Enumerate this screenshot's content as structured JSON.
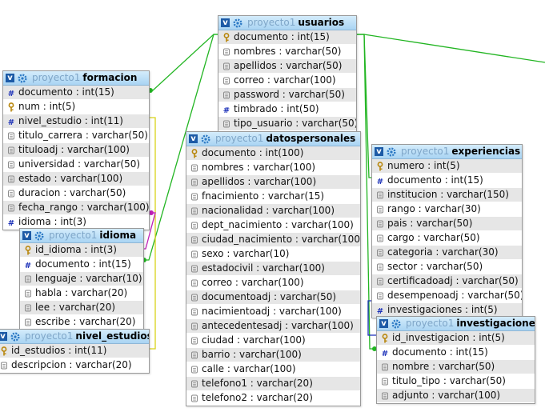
{
  "tables": {
    "usuarios": {
      "db": "proyecto1",
      "name": "usuarios",
      "columns": [
        {
          "icon": "key",
          "text": "documento : int(15)"
        },
        {
          "icon": "varchar",
          "text": "nombres : varchar(50)"
        },
        {
          "icon": "varchar",
          "text": "apellidos : varchar(50)"
        },
        {
          "icon": "varchar",
          "text": "correo : varchar(100)"
        },
        {
          "icon": "varchar",
          "text": "password : varchar(50)"
        },
        {
          "icon": "int",
          "text": "timbrado : int(50)"
        },
        {
          "icon": "varchar",
          "text": "tipo_usuario : varchar(50)"
        }
      ]
    },
    "formacion": {
      "db": "proyecto1",
      "name": "formacion",
      "columns": [
        {
          "icon": "int",
          "text": "documento : int(15)"
        },
        {
          "icon": "key",
          "text": "num : int(5)"
        },
        {
          "icon": "int",
          "text": "nivel_estudio : int(11)"
        },
        {
          "icon": "varchar",
          "text": "titulo_carrera : varchar(50)"
        },
        {
          "icon": "varchar",
          "text": "tituloadj : varchar(100)"
        },
        {
          "icon": "varchar",
          "text": "universidad : varchar(50)"
        },
        {
          "icon": "varchar",
          "text": "estado : varchar(100)"
        },
        {
          "icon": "varchar",
          "text": "duracion : varchar(50)"
        },
        {
          "icon": "varchar",
          "text": "fecha_rango : varchar(100)"
        },
        {
          "icon": "int",
          "text": "idioma : int(3)"
        }
      ]
    },
    "idioma": {
      "db": "proyecto1",
      "name": "idioma",
      "columns": [
        {
          "icon": "key",
          "text": "id_idioma : int(3)"
        },
        {
          "icon": "int",
          "text": "documento : int(15)"
        },
        {
          "icon": "varchar",
          "text": "lenguaje : varchar(10)"
        },
        {
          "icon": "varchar",
          "text": "habla : varchar(20)"
        },
        {
          "icon": "varchar",
          "text": "lee : varchar(20)"
        },
        {
          "icon": "varchar",
          "text": "escribe : varchar(20)"
        }
      ]
    },
    "nivel_estudios": {
      "db": "proyecto1",
      "name": "nivel_estudios",
      "columns": [
        {
          "icon": "key",
          "text": "id_estudios : int(11)"
        },
        {
          "icon": "varchar",
          "text": "descripcion : varchar(20)"
        }
      ]
    },
    "datospersonales": {
      "db": "proyecto1",
      "name": "datospersonales",
      "columns": [
        {
          "icon": "key",
          "text": "documento : int(100)"
        },
        {
          "icon": "varchar",
          "text": "nombres : varchar(100)"
        },
        {
          "icon": "varchar",
          "text": "apellidos : varchar(100)"
        },
        {
          "icon": "varchar",
          "text": "fnacimiento : varchar(15)"
        },
        {
          "icon": "varchar",
          "text": "nacionalidad : varchar(100)"
        },
        {
          "icon": "varchar",
          "text": "dept_nacimiento : varchar(100)"
        },
        {
          "icon": "varchar",
          "text": "ciudad_nacimiento : varchar(100)"
        },
        {
          "icon": "varchar",
          "text": "sexo : varchar(10)"
        },
        {
          "icon": "varchar",
          "text": "estadocivil : varchar(100)"
        },
        {
          "icon": "varchar",
          "text": "correo : varchar(100)"
        },
        {
          "icon": "varchar",
          "text": "documentoadj : varchar(50)"
        },
        {
          "icon": "varchar",
          "text": "nacimientoadj : varchar(100)"
        },
        {
          "icon": "varchar",
          "text": "antecedentesadj : varchar(100)"
        },
        {
          "icon": "varchar",
          "text": "ciudad : varchar(100)"
        },
        {
          "icon": "varchar",
          "text": "barrio : varchar(100)"
        },
        {
          "icon": "varchar",
          "text": "calle : varchar(100)"
        },
        {
          "icon": "varchar",
          "text": "telefono1 : varchar(20)"
        },
        {
          "icon": "varchar",
          "text": "telefono2 : varchar(20)"
        }
      ]
    },
    "experiencias": {
      "db": "proyecto1",
      "name": "experiencias",
      "columns": [
        {
          "icon": "key",
          "text": "numero : int(5)"
        },
        {
          "icon": "int",
          "text": "documento : int(15)"
        },
        {
          "icon": "varchar",
          "text": "institucion : varchar(150)"
        },
        {
          "icon": "varchar",
          "text": "rango : varchar(30)"
        },
        {
          "icon": "varchar",
          "text": "pais : varchar(50)"
        },
        {
          "icon": "varchar",
          "text": "cargo : varchar(50)"
        },
        {
          "icon": "varchar",
          "text": "categoria : varchar(30)"
        },
        {
          "icon": "varchar",
          "text": "sector : varchar(50)"
        },
        {
          "icon": "varchar",
          "text": "certificadoadj : varchar(50)"
        },
        {
          "icon": "varchar",
          "text": "desempenoadj : varchar(50)"
        },
        {
          "icon": "int",
          "text": "investigaciones : int(5)"
        }
      ]
    },
    "investigaciones": {
      "db": "proyecto1",
      "name": "investigaciones",
      "columns": [
        {
          "icon": "key",
          "text": "id_investigacion : int(5)"
        },
        {
          "icon": "int",
          "text": "documento : int(15)"
        },
        {
          "icon": "varchar",
          "text": "nombre : varchar(50)"
        },
        {
          "icon": "varchar",
          "text": "titulo_tipo : varchar(50)"
        },
        {
          "icon": "varchar",
          "text": "adjunto : varchar(100)"
        }
      ]
    }
  },
  "colors": {
    "header_gradient_top": "#d4ecfb",
    "header_gradient_bottom": "#a9d4f3",
    "db_name": "#7fa6c8",
    "relation_green": "#22b522",
    "relation_yellow": "#d8d21a",
    "relation_magenta": "#c020b8",
    "relation_blue": "#1a2fb8"
  }
}
